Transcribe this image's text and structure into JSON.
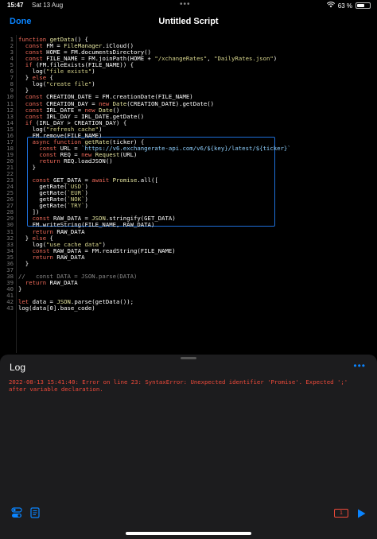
{
  "status_bar": {
    "time": "15:47",
    "date": "Sat 13 Aug",
    "battery_percent": "63 %",
    "battery_level": 0.63
  },
  "nav": {
    "done_label": "Done",
    "title": "Untitled Script"
  },
  "editor": {
    "lines": [
      {
        "num": "1",
        "html": "<span class=\"kw\">function</span> <span class=\"fn\">getData</span>() {"
      },
      {
        "num": "2",
        "html": "  <span class=\"kw\">const</span> FM = <span class=\"fn\">FileManager</span>.iCloud()"
      },
      {
        "num": "3",
        "html": "  <span class=\"kw\">const</span> HOME = FM.documentsDirectory()"
      },
      {
        "num": "4",
        "html": "  <span class=\"kw\">const</span> FILE_NAME = FM.joinPath(HOME + <span class=\"str\">\"/xchangeRates\"</span>, <span class=\"str\">\"DailyRates.json\"</span>)"
      },
      {
        "num": "5",
        "html": "  <span class=\"kw\">if</span> (FM.fileExists(FILE_NAME)) {"
      },
      {
        "num": "6",
        "html": "    log(<span class=\"str\">\"file exists\"</span>)"
      },
      {
        "num": "7",
        "html": "  } <span class=\"kw\">else</span> {"
      },
      {
        "num": "8",
        "html": "    log(<span class=\"str\">\"create file\"</span>)"
      },
      {
        "num": "9",
        "html": "  }"
      },
      {
        "num": "10",
        "html": "  <span class=\"kw\">const</span> CREATION_DATE = FM.creationDate(FILE_NAME)"
      },
      {
        "num": "11",
        "html": "  <span class=\"kw\">const</span> CREATION_DAY = <span class=\"kw\">new</span> <span class=\"fn\">Date</span>(CREATION_DATE).getDate()"
      },
      {
        "num": "12",
        "html": "  <span class=\"kw\">const</span> IRL_DATE = <span class=\"kw\">new</span> <span class=\"fn\">Date</span>()"
      },
      {
        "num": "13",
        "html": "  <span class=\"kw\">const</span> IRL_DAY = IRL_DATE.getDate()"
      },
      {
        "num": "14",
        "html": "  <span class=\"kw\">if</span> (IRL_DAY > CREATION_DAY) {"
      },
      {
        "num": "15",
        "html": "    log(<span class=\"str\">\"refresh cache\"</span>)"
      },
      {
        "num": "16",
        "html": "    FM.remove(FILE_NAME)"
      },
      {
        "num": "17",
        "html": "    <span class=\"kw\">async</span> <span class=\"kw\">function</span> <span class=\"fn\">getRate</span>(ticker) {"
      },
      {
        "num": "18",
        "html": "      <span class=\"kw\">const</span> URL = <span class=\"tpl\">`https://v6.exchangerate-api.com/v6/${key}/latest/${ticker}`</span>"
      },
      {
        "num": "19",
        "html": "      <span class=\"kw\">const</span> REQ = <span class=\"kw\">new</span> <span class=\"fn\">Request</span>(URL)"
      },
      {
        "num": "20",
        "html": "      <span class=\"kw\">return</span> REQ.loadJSON()"
      },
      {
        "num": "21",
        "html": "    }"
      },
      {
        "num": "22",
        "html": ""
      },
      {
        "num": "23",
        "html": "    <span class=\"kw\">const</span> GET_DATA = <span class=\"kw\">await</span> <span class=\"fn\">Promise</span>.all(["
      },
      {
        "num": "24",
        "html": "      getRate(<span class=\"str\">`USD`</span>)"
      },
      {
        "num": "25",
        "html": "      getRate(<span class=\"str\">`EUR`</span>)"
      },
      {
        "num": "26",
        "html": "      getRate(<span class=\"str\">`NOK`</span>)"
      },
      {
        "num": "27",
        "html": "      getRate(<span class=\"str\">`TRY`</span>)"
      },
      {
        "num": "28",
        "html": "    ])"
      },
      {
        "num": "29",
        "html": "    <span class=\"kw\">const</span> RAW_DATA = <span class=\"fn\">JSON</span>.stringify(GET_DATA)"
      },
      {
        "num": "30",
        "html": "    FM.writeString(FILE_NAME, RAW_DATA)"
      },
      {
        "num": "31",
        "html": "    <span class=\"kw\">return</span> RAW_DATA"
      },
      {
        "num": "32",
        "html": "  } <span class=\"kw\">else</span> {"
      },
      {
        "num": "33",
        "html": "    log(<span class=\"str\">\"use cache data\"</span>)"
      },
      {
        "num": "34",
        "html": "    <span class=\"kw\">const</span> RAW_DATA = FM.readString(FILE_NAME)"
      },
      {
        "num": "35",
        "html": "    <span class=\"kw\">return</span> RAW_DATA"
      },
      {
        "num": "36",
        "html": "  }"
      },
      {
        "num": "37",
        "html": ""
      },
      {
        "num": "38",
        "html": "<span class=\"cm\">//   const DATA = JSON.parse(DATA)</span>"
      },
      {
        "num": "39",
        "html": "  <span class=\"kw\">return</span> RAW_DATA"
      },
      {
        "num": "40",
        "html": "}"
      },
      {
        "num": "41",
        "html": ""
      },
      {
        "num": "42",
        "html": "<span class=\"kw\">let</span> data = <span class=\"fn\">JSON</span>.parse(getData());"
      },
      {
        "num": "43",
        "html": "log(data[0].base_code)"
      }
    ]
  },
  "log": {
    "title": "Log",
    "message": "2022-08-13 15:41:40: Error on line 23: SyntaxError: Unexpected identifier 'Promise'. Expected ';' after variable declaration."
  },
  "toolbar": {
    "error_count": "1"
  },
  "colors": {
    "accent": "#0a84ff",
    "error": "#f04a3a",
    "selection": "#1e6fd9"
  }
}
